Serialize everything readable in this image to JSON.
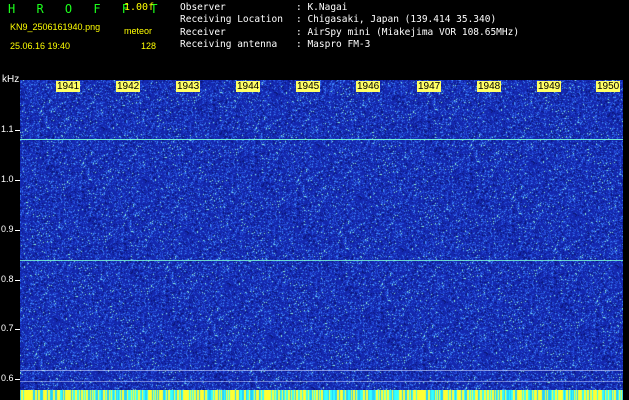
{
  "header": {
    "app_title": "H R O F F T",
    "version": "1.00f",
    "filename": "KN9_2506161940.png",
    "mode": "meteor",
    "datetime": "25.06.16 19:40",
    "count": "128"
  },
  "station": [
    {
      "key": "Observer",
      "value": ": K.Nagai"
    },
    {
      "key": "Receiving Location",
      "value": ": Chigasaki, Japan (139.414 35.340)"
    },
    {
      "key": "Receiver",
      "value": ": AirSpy mini (Miakejima VOR 108.65MHz)"
    },
    {
      "key": "Receiving antenna",
      "value": ": Maspro FM-3"
    }
  ],
  "spectrogram": {
    "unit": "kHz",
    "y_ticks": [
      "1.1",
      "1.0",
      "0.9",
      "0.8",
      "0.7",
      "0.6"
    ],
    "time_labels": [
      "1941",
      "1942",
      "1943",
      "1944",
      "1945",
      "1946",
      "1947",
      "1948",
      "1949",
      "1950"
    ],
    "colors": {
      "background": "#1a2fb8",
      "noise": "#3d7cff",
      "signal": "#7dffd8",
      "bar": "#ffff33"
    }
  }
}
